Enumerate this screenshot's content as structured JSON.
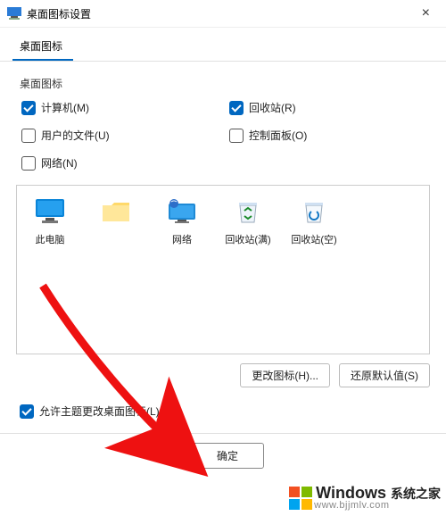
{
  "window": {
    "title": "桌面图标设置",
    "close_label": "×"
  },
  "tab": {
    "label": "桌面图标"
  },
  "group": {
    "label": "桌面图标"
  },
  "checkboxes": {
    "computer": {
      "label": "计算机(M)",
      "checked": true
    },
    "recyclebin": {
      "label": "回收站(R)",
      "checked": true
    },
    "userfiles": {
      "label": "用户的文件(U)",
      "checked": false
    },
    "controlpanel": {
      "label": "控制面板(O)",
      "checked": false
    },
    "network": {
      "label": "网络(N)",
      "checked": false
    }
  },
  "icons": {
    "thispc": {
      "label": "此电脑"
    },
    "folder": {
      "label": " "
    },
    "network": {
      "label": "网络"
    },
    "bin_full": {
      "label": "回收站(满)"
    },
    "bin_empty": {
      "label": "回收站(空)"
    }
  },
  "buttons": {
    "change_icon": "更改图标(H)...",
    "restore_default": "还原默认值(S)",
    "ok": "确定"
  },
  "allow_themes": {
    "label": "允许主题更改桌面图标(L)",
    "checked": true
  },
  "watermark": {
    "text": "Windows",
    "sub": "系统之家",
    "url": "www.bjjmlv.com"
  }
}
